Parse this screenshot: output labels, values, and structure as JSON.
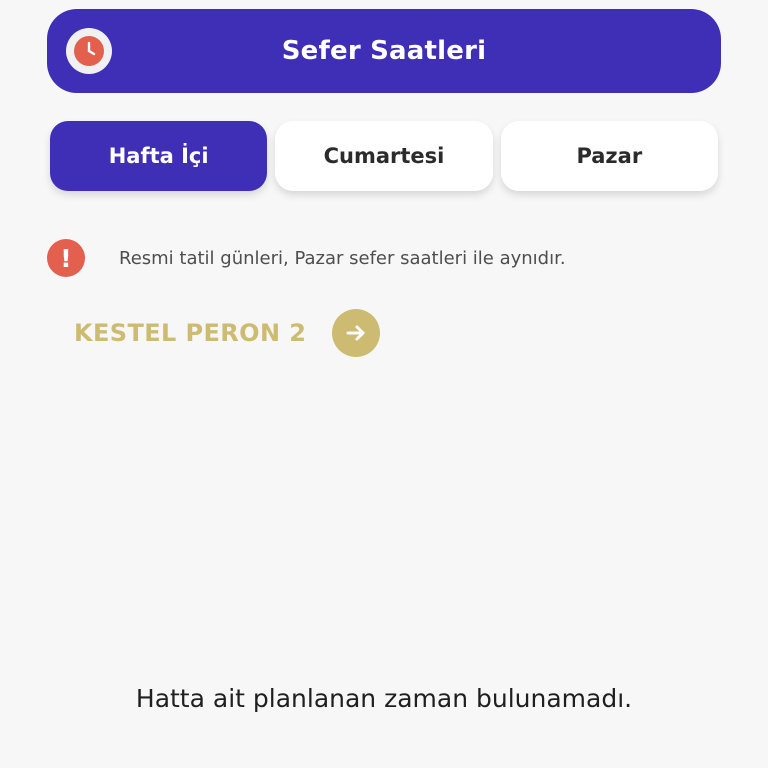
{
  "header": {
    "title": "Sefer Saatleri",
    "icon": "clock-icon"
  },
  "tabs": [
    {
      "label": "Hafta İçi",
      "active": true
    },
    {
      "label": "Cumartesi",
      "active": false
    },
    {
      "label": "Pazar",
      "active": false
    }
  ],
  "notice": {
    "icon": "exclamation-icon",
    "text": "Resmi tatil günleri, Pazar sefer saatleri ile aynıdır."
  },
  "station": {
    "name": "KESTEL PERON 2",
    "icon": "arrow-right-icon"
  },
  "empty_message": "Hatta ait planlanan zaman bulunamadı.",
  "colors": {
    "primary": "#3f2eb6",
    "accent_gold": "#cdbb72",
    "alert_red": "#e2604d",
    "background": "#f7f7f8"
  }
}
